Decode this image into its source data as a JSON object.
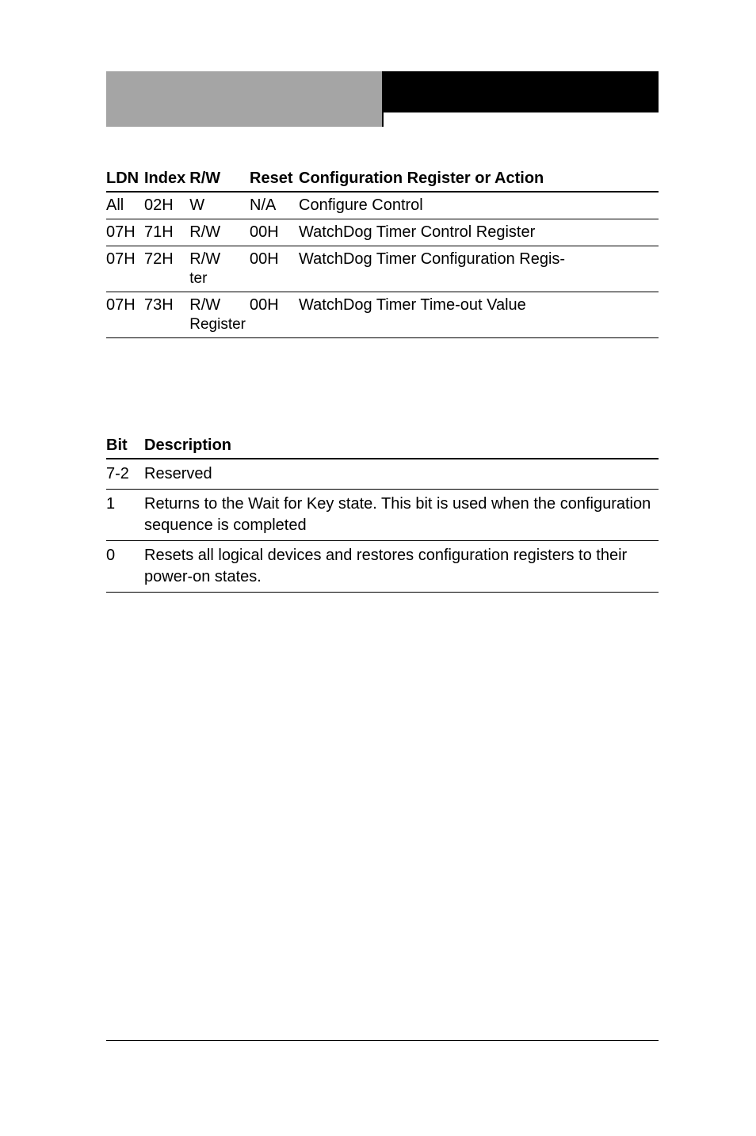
{
  "table1": {
    "headers": {
      "ldn": "LDN",
      "index": "Index",
      "rw": "R/W",
      "reset": "Reset",
      "desc": "Configuration Register or Action"
    },
    "rows": [
      {
        "ldn": "All",
        "index": "02H",
        "rw": "W",
        "reset": "N/A",
        "desc": "Configure Control",
        "rw_suffix": ""
      },
      {
        "ldn": "07H",
        "index": "71H",
        "rw": "R/W",
        "reset": "00H",
        "desc": "WatchDog Timer Control Register",
        "rw_suffix": ""
      },
      {
        "ldn": "07H",
        "index": "72H",
        "rw": "R/W",
        "reset": "00H",
        "desc": "WatchDog Timer Configuration Regis-",
        "rw_suffix": "ter"
      },
      {
        "ldn": "07H",
        "index": "73H",
        "rw": "R/W",
        "reset": "00H",
        "desc": "WatchDog Timer Time-out Value",
        "rw_suffix": "Register"
      }
    ]
  },
  "table2": {
    "headers": {
      "bit": "Bit",
      "desc": "Description"
    },
    "rows": [
      {
        "bit": "7-2",
        "desc": "Reserved"
      },
      {
        "bit": "1",
        "desc": "Returns to the Wait for Key state. This bit is used when the configuration sequence is completed"
      },
      {
        "bit": "0",
        "desc": "Resets all logical devices and restores configuration registers to their power-on states."
      }
    ]
  }
}
